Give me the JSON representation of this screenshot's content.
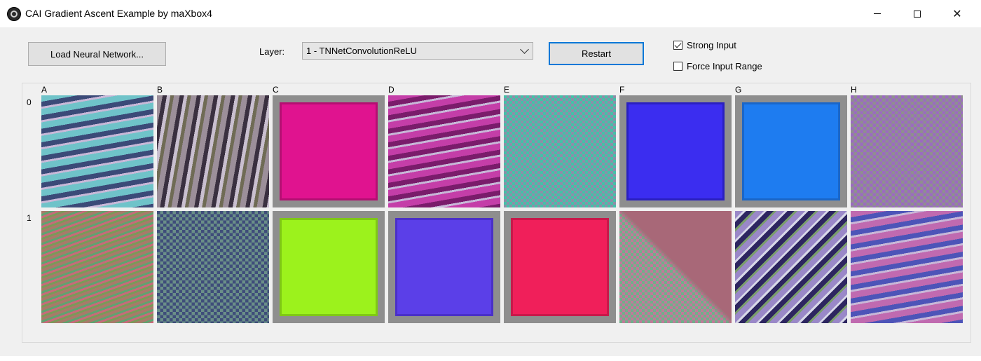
{
  "window": {
    "title": "CAI Gradient Ascent Example by maXbox4",
    "minimize_glyph": "",
    "maximize_glyph": "",
    "close_glyph": "✕"
  },
  "toolbar": {
    "load_label": "Load Neural Network...",
    "layer_label": "Layer:",
    "layer_value": "1 - TNNetConvolutionReLU",
    "restart_label": "Restart"
  },
  "options": {
    "strong_input_label": "Strong Input",
    "strong_input_checked": true,
    "force_range_label": "Force Input Range",
    "force_range_checked": false
  },
  "grid": {
    "columns": [
      "A",
      "B",
      "C",
      "D",
      "E",
      "F",
      "G",
      "H"
    ],
    "rows": [
      "0",
      "1"
    ],
    "tiles": [
      [
        {
          "base": "#6fc3c9",
          "accent": "#3b4a78",
          "pattern": "waves"
        },
        {
          "base": "#9c8f9a",
          "accent": "#3a3040",
          "pattern": "stripes-v"
        },
        {
          "base": "#e0138f",
          "accent": "#b40f72",
          "pattern": "solid"
        },
        {
          "base": "#c43ea8",
          "accent": "#7a1c6b",
          "pattern": "waves"
        },
        {
          "base": "#8c8fa8",
          "accent": "#44c1a8",
          "pattern": "noise"
        },
        {
          "base": "#3b2df0",
          "accent": "#2a20c0",
          "pattern": "solid"
        },
        {
          "base": "#1e7cf0",
          "accent": "#1a66c8",
          "pattern": "solid"
        },
        {
          "base": "#8f8f8f",
          "accent": "#9b6bc0",
          "pattern": "checker"
        }
      ],
      [
        {
          "base": "#a87a6a",
          "accent": "#5fa36f",
          "pattern": "stripes-d"
        },
        {
          "base": "#6a8f88",
          "accent": "#3f4d7a",
          "pattern": "checker"
        },
        {
          "base": "#9cf21c",
          "accent": "#7fc815",
          "pattern": "solid"
        },
        {
          "base": "#5b3fe8",
          "accent": "#4a30c8",
          "pattern": "solid"
        },
        {
          "base": "#f01f5a",
          "accent": "#c8184a",
          "pattern": "solid"
        },
        {
          "base": "#a86878",
          "accent": "#6fb08a",
          "pattern": "triangle"
        },
        {
          "base": "#9a88c8",
          "accent": "#2d2560",
          "pattern": "stripes-d2"
        },
        {
          "base": "#c06ab0",
          "accent": "#4d54b8",
          "pattern": "waves"
        }
      ]
    ]
  }
}
